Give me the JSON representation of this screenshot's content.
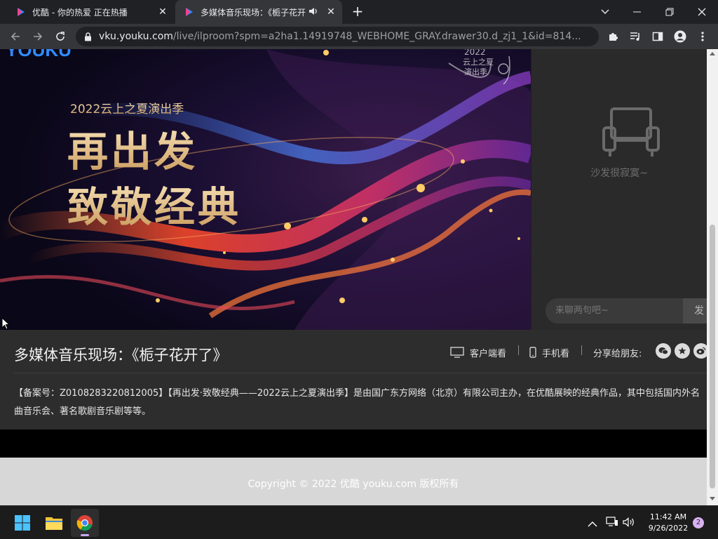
{
  "browser": {
    "tabs": [
      {
        "title": "优酷 - 你的热爱 正在热播",
        "active": false
      },
      {
        "title": "多媒体音乐现场：《栀子花开了》",
        "active": true
      }
    ],
    "url_host": "vku.youku.com",
    "url_path": "/live/ilproom?spm=a2ha1.14919748_WEBHOME_GRAY.drawer30.d_zj1_1&id=814..."
  },
  "video": {
    "brand_text": "YOUKU",
    "poster_small": "2022云上之夏演出季",
    "poster_line1": "再出发",
    "poster_line2": "致敬经典",
    "corner_top": "2022",
    "corner_mid": "云上之夏",
    "corner_bot": "演出季"
  },
  "chat": {
    "empty_text": "沙发很寂寞~",
    "placeholder": "来聊两句吧~",
    "send_label": "发"
  },
  "info": {
    "title": "多媒体音乐现场：《栀子花开了》",
    "client_watch": "客户端看",
    "mobile_watch": "手机看",
    "share_label": "分享给朋友:",
    "description": "【备案号：Z0108283220812005】【再出发·致敬经典——2022云上之夏演出季】是由国广东方网络（北京）有限公司主办，在优酷展映的经典作品，其中包括国内外名曲音乐会、著名歌剧音乐剧等等。"
  },
  "footer": {
    "copyright": "Copyright © 2022 优酷 youku.com 版权所有"
  },
  "taskbar": {
    "time": "11:42 AM",
    "date": "9/26/2022",
    "notifications": "2"
  },
  "colors": {
    "youku_blue": "#2f8cff",
    "youku_pink": "#ff3e8a",
    "gold": "#e8c48a"
  }
}
